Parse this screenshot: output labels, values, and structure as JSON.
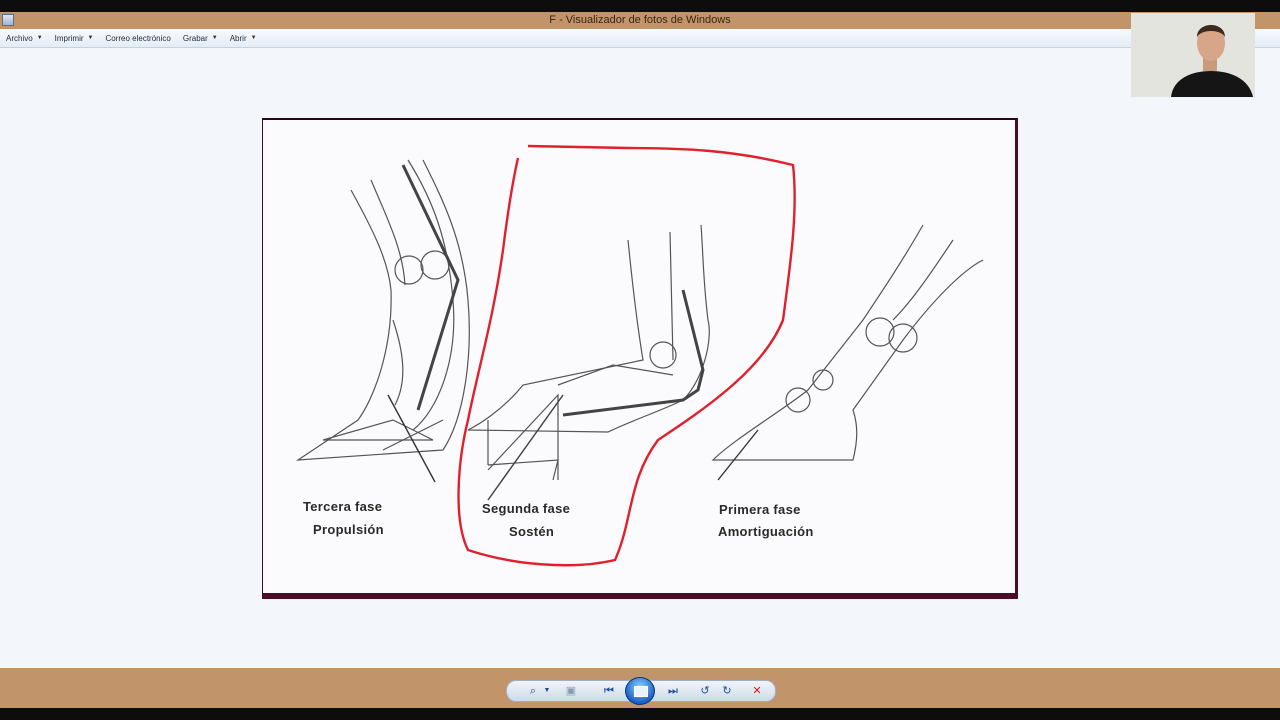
{
  "window": {
    "title": "F - Visualizador de fotos de Windows"
  },
  "menu": [
    {
      "label": "Archivo",
      "dropdown": true
    },
    {
      "label": "Imprimir",
      "dropdown": true
    },
    {
      "label": "Correo electrónico",
      "dropdown": false
    },
    {
      "label": "Grabar",
      "dropdown": true
    },
    {
      "label": "Abrir",
      "dropdown": true
    }
  ],
  "photo": {
    "captions": {
      "third_phase": "Tercera fase",
      "third_name": "Propulsión",
      "second_phase": "Segunda fase",
      "second_name": "Sostén",
      "first_phase": "Primera fase",
      "first_name": "Amortiguación"
    },
    "annotation_color": "#e0202c"
  },
  "controls": {
    "zoom": "magnifier-icon",
    "fit": "actual-size-icon",
    "prev": "previous-icon",
    "slideshow": "slideshow-icon",
    "next": "next-icon",
    "rotate_ccw": "rotate-left-icon",
    "rotate_cw": "rotate-right-icon",
    "delete": "delete-icon"
  },
  "colors": {
    "frame": "#c2946a",
    "viewer_bg": "#f3f6fa",
    "accent": "#1c62c4"
  }
}
